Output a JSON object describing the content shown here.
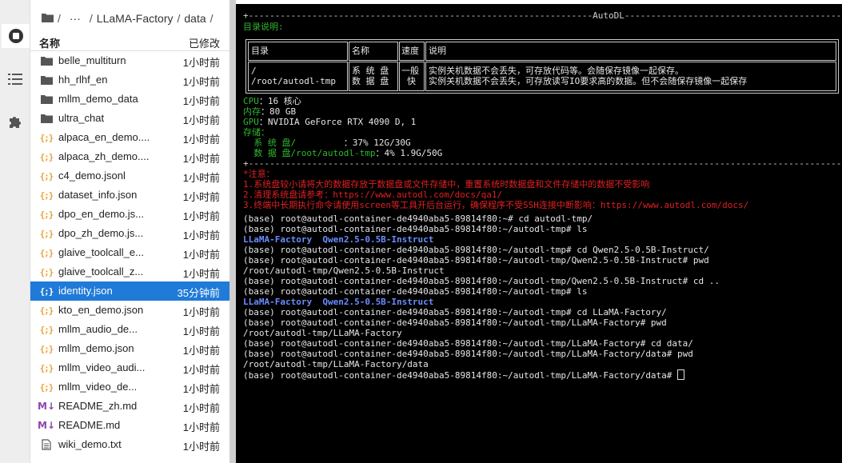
{
  "breadcrumb": {
    "sep1": "/",
    "ellipsis": "···",
    "sep2": "/",
    "folder1": "LLaMA-Factory",
    "sep3": "/",
    "folder2": "data",
    "sep4": "/"
  },
  "columns": {
    "name": "名称",
    "modified": "已修改"
  },
  "files": [
    {
      "name": "belle_multiturn",
      "time": "1小时前",
      "type": "folder"
    },
    {
      "name": "hh_rlhf_en",
      "time": "1小时前",
      "type": "folder"
    },
    {
      "name": "mllm_demo_data",
      "time": "1小时前",
      "type": "folder"
    },
    {
      "name": "ultra_chat",
      "time": "1小时前",
      "type": "folder"
    },
    {
      "name": "alpaca_en_demo....",
      "time": "1小时前",
      "type": "json"
    },
    {
      "name": "alpaca_zh_demo....",
      "time": "1小时前",
      "type": "json"
    },
    {
      "name": "c4_demo.jsonl",
      "time": "1小时前",
      "type": "json"
    },
    {
      "name": "dataset_info.json",
      "time": "1小时前",
      "type": "json"
    },
    {
      "name": "dpo_en_demo.js...",
      "time": "1小时前",
      "type": "json"
    },
    {
      "name": "dpo_zh_demo.js...",
      "time": "1小时前",
      "type": "json"
    },
    {
      "name": "glaive_toolcall_e...",
      "time": "1小时前",
      "type": "json"
    },
    {
      "name": "glaive_toolcall_z...",
      "time": "1小时前",
      "type": "json"
    },
    {
      "name": "identity.json",
      "time": "35分钟前",
      "type": "json",
      "selected": true
    },
    {
      "name": "kto_en_demo.json",
      "time": "1小时前",
      "type": "json"
    },
    {
      "name": "mllm_audio_de...",
      "time": "1小时前",
      "type": "json"
    },
    {
      "name": "mllm_demo.json",
      "time": "1小时前",
      "type": "json"
    },
    {
      "name": "mllm_video_audi...",
      "time": "1小时前",
      "type": "json"
    },
    {
      "name": "mllm_video_de...",
      "time": "1小时前",
      "type": "json"
    },
    {
      "name": "README_zh.md",
      "time": "1小时前",
      "type": "md"
    },
    {
      "name": "README.md",
      "time": "1小时前",
      "type": "md"
    },
    {
      "name": "wiki_demo.txt",
      "time": "1小时前",
      "type": "txt"
    }
  ],
  "terminal": {
    "banner": "+-----------------------------------------------------------------AutoDL------------------------------------------------------------------",
    "dir_title": "目录说明:",
    "table": {
      "h_dir": "目录",
      "h_name": "名称",
      "h_speed": "速度",
      "h_desc": "说明",
      "r_dir1": "/",
      "r_dir2": "/root/autodl-tmp",
      "r_name1": "系 统 盘",
      "r_name2": "数 据 盘",
      "r_speed1": "一般",
      "r_speed2": "快",
      "r_desc1": "实例关机数据不会丢失，可存放代码等。会随保存镜像一起保存。",
      "r_desc2": "实例关机数据不会丢失，可存放读写IO要求高的数据。但不会随保存镜像一起保存"
    },
    "cpu_label": "CPU",
    "cpu_val": "：16 核心",
    "mem_label": "内存",
    "mem_val": "：80 GB",
    "gpu_label": "GPU",
    "gpu_val": "：NVIDIA GeForce RTX 4090 D, 1",
    "storage_label": "存储：",
    "sys_label": "  系 统 盘/",
    "sys_val": "         ：37% 12G/30G",
    "data_label": "  数 据 盘/root/autodl-tmp",
    "data_val": "：4% 1.9G/50G",
    "divider": "+---------------------------------------------------------------------------------------------------------------------------------------",
    "notice_title": "*注意：",
    "notice1": "1.系统盘较小请将大的数据存放于数据盘或文件存储中，重置系统时数据盘和文件存储中的数据不受影响",
    "notice2": "2.清理系统盘请参考：https://www.autodl.com/docs/qa1/",
    "notice3": "3.终端中长期执行命令请使用screen等工具开后台运行，确保程序不受SSH连接中断影响：https://www.autodl.com/docs/",
    "lines": [
      {
        "t": "(base) root@autodl-container-de4940aba5-89814f80:~# cd autodl-tmp/",
        "c": "w"
      },
      {
        "t": "(base) root@autodl-container-de4940aba5-89814f80:~/autodl-tmp# ls",
        "c": "w"
      },
      {
        "t": "LLaMA-Factory  Qwen2.5-0.5B-Instruct",
        "c": "b"
      },
      {
        "t": "(base) root@autodl-container-de4940aba5-89814f80:~/autodl-tmp# cd Qwen2.5-0.5B-Instruct/",
        "c": "w"
      },
      {
        "t": "(base) root@autodl-container-de4940aba5-89814f80:~/autodl-tmp/Qwen2.5-0.5B-Instruct# pwd",
        "c": "w"
      },
      {
        "t": "/root/autodl-tmp/Qwen2.5-0.5B-Instruct",
        "c": "w"
      },
      {
        "t": "(base) root@autodl-container-de4940aba5-89814f80:~/autodl-tmp/Qwen2.5-0.5B-Instruct# cd ..",
        "c": "w"
      },
      {
        "t": "(base) root@autodl-container-de4940aba5-89814f80:~/autodl-tmp# ls",
        "c": "w"
      },
      {
        "t": "LLaMA-Factory  Qwen2.5-0.5B-Instruct",
        "c": "b"
      },
      {
        "t": "(base) root@autodl-container-de4940aba5-89814f80:~/autodl-tmp# cd LLaMA-Factory/",
        "c": "w"
      },
      {
        "t": "(base) root@autodl-container-de4940aba5-89814f80:~/autodl-tmp/LLaMA-Factory# pwd",
        "c": "w"
      },
      {
        "t": "/root/autodl-tmp/LLaMA-Factory",
        "c": "w"
      },
      {
        "t": "(base) root@autodl-container-de4940aba5-89814f80:~/autodl-tmp/LLaMA-Factory# cd data/",
        "c": "w"
      },
      {
        "t": "(base) root@autodl-container-de4940aba5-89814f80:~/autodl-tmp/LLaMA-Factory/data# pwd",
        "c": "w"
      },
      {
        "t": "/root/autodl-tmp/LLaMA-Factory/data",
        "c": "w"
      },
      {
        "t": "(base) root@autodl-container-de4940aba5-89814f80:~/autodl-tmp/LLaMA-Factory/data# ",
        "c": "w"
      }
    ]
  },
  "colors": {
    "selection": "#1f7ad8",
    "folder": "#555555",
    "json": "#e8a33a",
    "markdown": "#8e44ad",
    "term_green": "#2fb82f",
    "term_red": "#e02020",
    "term_blue": "#6a8cff"
  }
}
